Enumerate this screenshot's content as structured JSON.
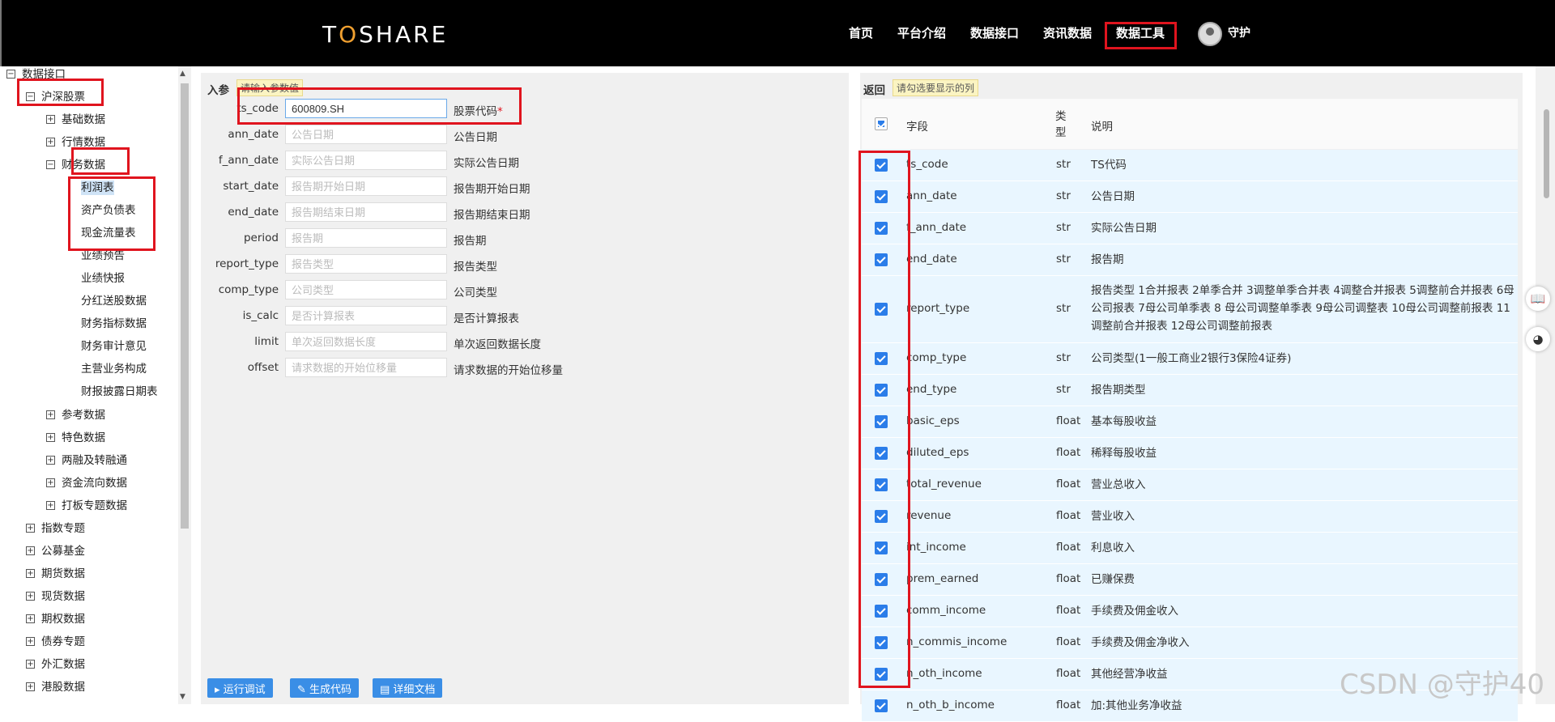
{
  "header": {
    "logo_pre": "T",
    "logo_o": "O",
    "logo_post": "SHARE",
    "nav": [
      "首页",
      "平台介绍",
      "数据接口",
      "资讯数据",
      "数据工具"
    ],
    "user": "守护"
  },
  "sidebar": {
    "root": "数据接口",
    "group": "沪深股票",
    "sub": [
      "基础数据",
      "行情数据",
      "财务数据"
    ],
    "finance_items": [
      "利润表",
      "资产负债表",
      "现金流量表",
      "业绩预告",
      "业绩快报",
      "分红送股数据",
      "财务指标数据",
      "财务审计意见",
      "主营业务构成",
      "财报披露日期表"
    ],
    "sub_after": [
      "参考数据",
      "特色数据",
      "两融及转融通",
      "资金流向数据",
      "打板专题数据"
    ],
    "top_after": [
      "指数专题",
      "公募基金",
      "期货数据",
      "现货数据",
      "期权数据",
      "债券专题",
      "外汇数据",
      "港股数据"
    ]
  },
  "input_panel": {
    "title": "入参",
    "hint": "请输入参数值",
    "params": [
      {
        "name": "ts_code",
        "value": "600809.SH",
        "placeholder": "",
        "desc": "股票代码",
        "required": "*"
      },
      {
        "name": "ann_date",
        "value": "",
        "placeholder": "公告日期",
        "desc": "公告日期",
        "required": ""
      },
      {
        "name": "f_ann_date",
        "value": "",
        "placeholder": "实际公告日期",
        "desc": "实际公告日期",
        "required": ""
      },
      {
        "name": "start_date",
        "value": "",
        "placeholder": "报告期开始日期",
        "desc": "报告期开始日期",
        "required": ""
      },
      {
        "name": "end_date",
        "value": "",
        "placeholder": "报告期结束日期",
        "desc": "报告期结束日期",
        "required": ""
      },
      {
        "name": "period",
        "value": "",
        "placeholder": "报告期",
        "desc": "报告期",
        "required": ""
      },
      {
        "name": "report_type",
        "value": "",
        "placeholder": "报告类型",
        "desc": "报告类型",
        "required": ""
      },
      {
        "name": "comp_type",
        "value": "",
        "placeholder": "公司类型",
        "desc": "公司类型",
        "required": ""
      },
      {
        "name": "is_calc",
        "value": "",
        "placeholder": "是否计算报表",
        "desc": "是否计算报表",
        "required": ""
      },
      {
        "name": "limit",
        "value": "",
        "placeholder": "单次返回数据长度",
        "desc": "单次返回数据长度",
        "required": ""
      },
      {
        "name": "offset",
        "value": "",
        "placeholder": "请求数据的开始位移量",
        "desc": "请求数据的开始位移量",
        "required": ""
      }
    ],
    "buttons": [
      "运行调试",
      "生成代码",
      "详细文档"
    ]
  },
  "output_panel": {
    "title": "返回",
    "hint": "请勾选要显示的列",
    "headers": [
      "字段",
      "类型",
      "说明"
    ],
    "rows": [
      {
        "field": "ts_code",
        "type": "str",
        "desc": "TS代码"
      },
      {
        "field": "ann_date",
        "type": "str",
        "desc": "公告日期"
      },
      {
        "field": "f_ann_date",
        "type": "str",
        "desc": "实际公告日期"
      },
      {
        "field": "end_date",
        "type": "str",
        "desc": "报告期"
      },
      {
        "field": "report_type",
        "type": "str",
        "desc": "报告类型 1合并报表 2单季合并 3调整单季合并表 4调整合并报表 5调整前合并报表 6母公司报表 7母公司单季表 8 母公司调整单季表 9母公司调整表 10母公司调整前报表 11调整前合并报表 12母公司调整前报表"
      },
      {
        "field": "comp_type",
        "type": "str",
        "desc": "公司类型(1一般工商业2银行3保险4证券)"
      },
      {
        "field": "end_type",
        "type": "str",
        "desc": "报告期类型"
      },
      {
        "field": "basic_eps",
        "type": "float",
        "desc": "基本每股收益"
      },
      {
        "field": "diluted_eps",
        "type": "float",
        "desc": "稀释每股收益"
      },
      {
        "field": "total_revenue",
        "type": "float",
        "desc": "营业总收入"
      },
      {
        "field": "revenue",
        "type": "float",
        "desc": "营业收入"
      },
      {
        "field": "int_income",
        "type": "float",
        "desc": "利息收入"
      },
      {
        "field": "prem_earned",
        "type": "float",
        "desc": "已赚保费"
      },
      {
        "field": "comm_income",
        "type": "float",
        "desc": "手续费及佣金收入"
      },
      {
        "field": "n_commis_income",
        "type": "float",
        "desc": "手续费及佣金净收入"
      },
      {
        "field": "n_oth_income",
        "type": "float",
        "desc": "其他经营净收益"
      },
      {
        "field": "n_oth_b_income",
        "type": "float",
        "desc": "加:其他业务净收益"
      }
    ]
  },
  "watermark": "CSDN @守护40"
}
